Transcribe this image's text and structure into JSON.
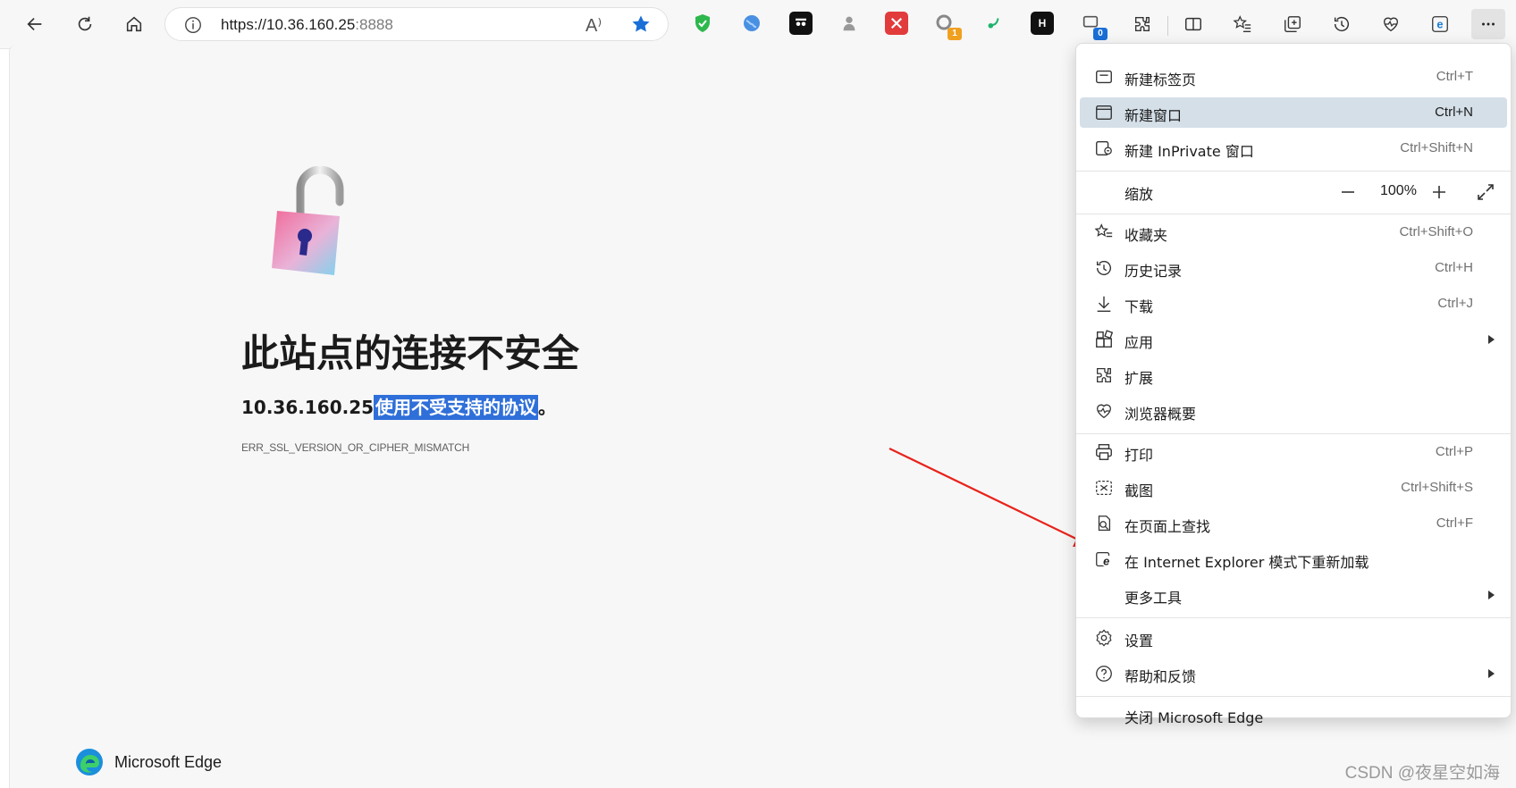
{
  "toolbar": {
    "url_main": "https://10.36.160.25",
    "url_port": ":8888",
    "read_aloud": "A⁾",
    "extension_badges": {
      "badge_one": "1",
      "badge_zero": "0"
    },
    "ext_letter": "H"
  },
  "page": {
    "title": "此站点的连接不安全",
    "desc_host": "10.36.160.25",
    "desc_highlight": "使用不受支持的协议",
    "desc_end": "。",
    "error_code": "ERR_SSL_VERSION_OR_CIPHER_MISMATCH",
    "brand": "Microsoft Edge"
  },
  "menu": {
    "new_tab": {
      "label": "新建标签页",
      "shortcut": "Ctrl+T"
    },
    "new_window": {
      "label": "新建窗口",
      "shortcut": "Ctrl+N"
    },
    "new_inprivate": {
      "label": "新建 InPrivate 窗口",
      "shortcut": "Ctrl+Shift+N"
    },
    "zoom": {
      "label": "缩放",
      "value": "100%"
    },
    "favorites": {
      "label": "收藏夹",
      "shortcut": "Ctrl+Shift+O"
    },
    "history": {
      "label": "历史记录",
      "shortcut": "Ctrl+H"
    },
    "downloads": {
      "label": "下载",
      "shortcut": "Ctrl+J"
    },
    "apps": {
      "label": "应用"
    },
    "extensions": {
      "label": "扩展"
    },
    "essentials": {
      "label": "浏览器概要"
    },
    "print": {
      "label": "打印",
      "shortcut": "Ctrl+P"
    },
    "screenshot": {
      "label": "截图",
      "shortcut": "Ctrl+Shift+S"
    },
    "find": {
      "label": "在页面上查找",
      "shortcut": "Ctrl+F"
    },
    "ie_mode": {
      "label": "在 Internet Explorer 模式下重新加载"
    },
    "more_tools": {
      "label": "更多工具"
    },
    "settings": {
      "label": "设置"
    },
    "help": {
      "label": "帮助和反馈"
    },
    "close": {
      "label": "关闭 Microsoft Edge"
    }
  },
  "watermark": "CSDN @夜星空如海",
  "colors": {
    "accent": "#2f6fd9",
    "menu_active": "#d4dfe8",
    "arrow": "#e8231c"
  }
}
